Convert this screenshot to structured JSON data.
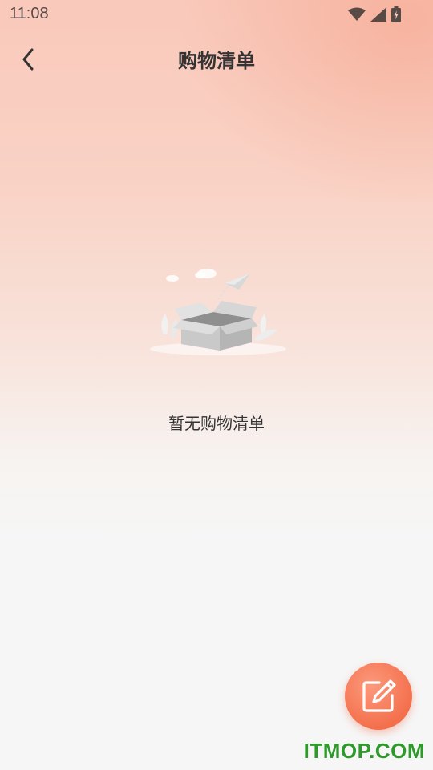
{
  "status_bar": {
    "time": "11:08",
    "icons": [
      "wifi-icon",
      "signal-icon",
      "battery-charging-icon"
    ]
  },
  "header": {
    "back_icon": "chevron-left-icon",
    "title": "购物清单"
  },
  "empty_state": {
    "illustration": "empty-box-illustration",
    "message": "暂无购物清单"
  },
  "fab": {
    "icon": "edit-icon",
    "color": "#f4704d"
  },
  "watermark": "ITMOP.COM",
  "colors": {
    "gradient_top": "#f9c9bb",
    "background": "#f6f6f6",
    "accent": "#f4704d",
    "title_text": "#333333",
    "watermark": "#2f9a2c"
  }
}
